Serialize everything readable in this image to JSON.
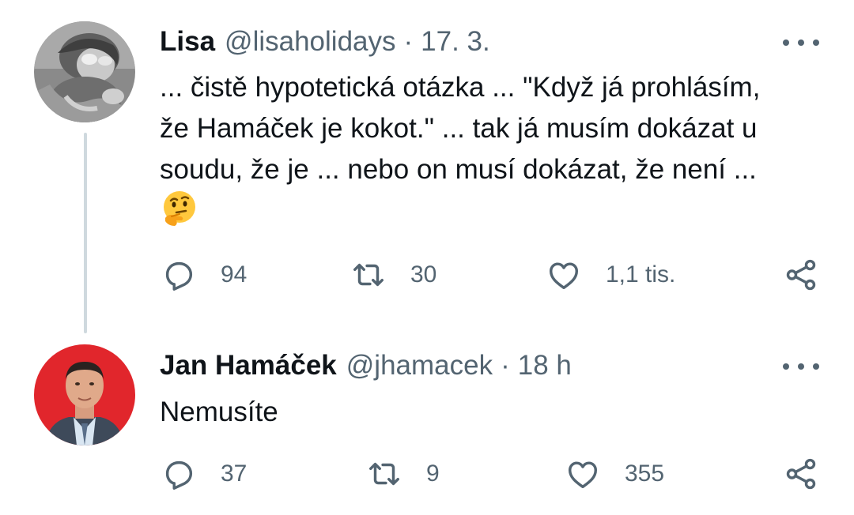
{
  "tweets": [
    {
      "name": "Lisa",
      "handle": "@lisaholidays",
      "separator": "·",
      "time": "17. 3.",
      "text_lines": [
        "... čistě hypotetická otázka ... \"Když já prohlásím,",
        "že Hamáček je kokot.\" ... tak já musím dokázat u",
        "soudu, že je ... nebo on musí dokázat, že není ..."
      ],
      "emoji": "thinking-face-icon",
      "replies": "94",
      "retweets": "30",
      "likes": "1,1 tis."
    },
    {
      "name": "Jan Hamáček",
      "handle": "@jhamacek",
      "separator": "·",
      "time": "18 h",
      "text_lines": [
        "Nemusíte"
      ],
      "replies": "37",
      "retweets": "9",
      "likes": "355"
    }
  ],
  "colors": {
    "text": "#0f1419",
    "secondary": "#536471",
    "thread_line": "#cfd9de",
    "avatar2_bg": "#e1262c"
  }
}
